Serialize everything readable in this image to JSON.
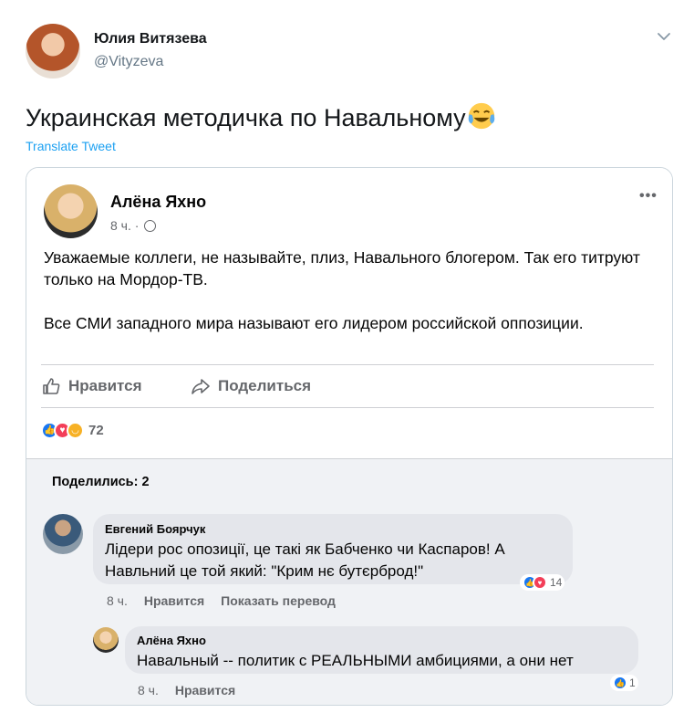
{
  "tweet": {
    "author_name": "Юлия Витязева",
    "author_handle": "@Vityzeva",
    "text": "Украинская методичка по Навальному",
    "emoji": "tears-of-joy",
    "translate_label": "Translate Tweet"
  },
  "fb_post": {
    "author_name": "Алёна Яхно",
    "time": "8 ч. ·",
    "paragraph_1": "Уважаемые коллеги, не называйте, плиз, Навального блогером. Так его титруют только на Мордор-ТВ.",
    "paragraph_2": "Все СМИ западного мира называют его лидером российской оппозиции.",
    "like_label": "Нравится",
    "share_label": "Поделиться",
    "reaction_count": "72",
    "reaction_types": [
      "like",
      "love",
      "haha"
    ]
  },
  "comments_section": {
    "shared_label": "Поделились: 2",
    "comments": [
      {
        "author": "Евгений Боярчук",
        "text": "Лідери рос опозиції, це такі як Бабченко чи Каспаров! А Навльний це той який: \"Крим нє бутєрброд!\"",
        "time": "8 ч.",
        "like_label": "Нравится",
        "translate_label": "Показать перевод",
        "reaction_count": "14",
        "reaction_types": [
          "like",
          "love"
        ]
      },
      {
        "author": "Алёна Яхно",
        "text": "Навальный -- политик с РЕАЛЬНЫМИ амбициями, а они нет",
        "time": "8 ч.",
        "like_label": "Нравится",
        "reaction_count": "1",
        "reaction_types": [
          "like"
        ]
      }
    ]
  },
  "colors": {
    "twitter_blue": "#1da1f2",
    "fb_blue": "#1877f2",
    "fb_love": "#f33e58",
    "fb_haha": "#f7b125"
  }
}
